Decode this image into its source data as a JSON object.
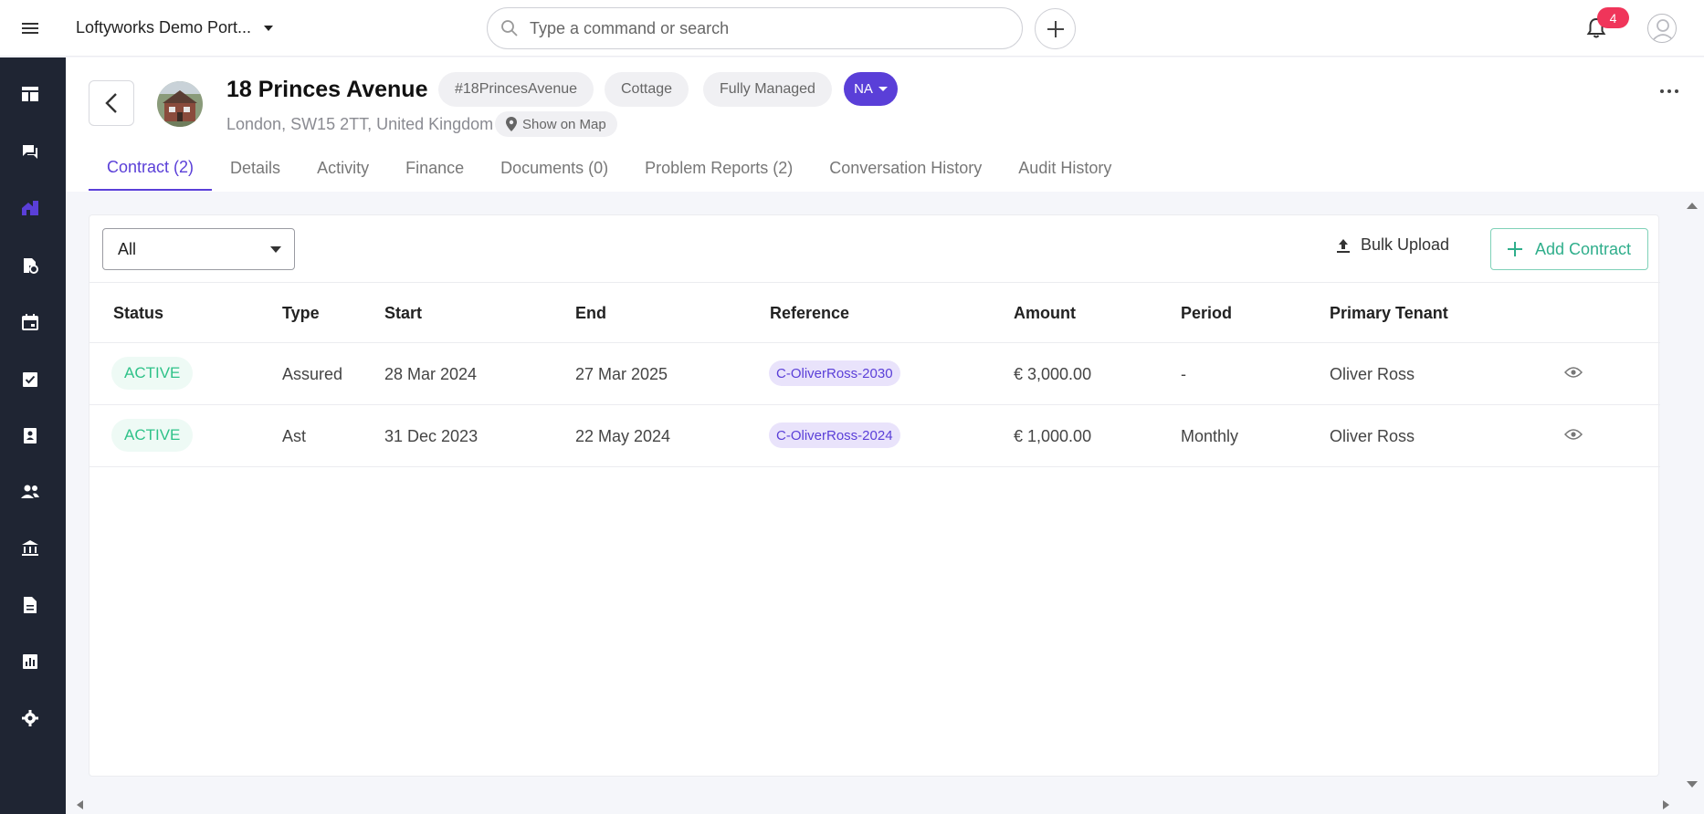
{
  "header": {
    "portfolio_name": "Loftyworks Demo Port...",
    "search_placeholder": "Type a command or search",
    "notification_count": "4"
  },
  "sidebar": {
    "items": [
      "dashboard-icon",
      "messages-icon",
      "properties-icon",
      "tenancies-icon",
      "calendar-icon",
      "tasks-icon",
      "contacts-icon",
      "people-icon",
      "bank-icon",
      "documents-icon",
      "reports-icon",
      "settings-icon"
    ],
    "active_index": 2,
    "bg_color": "#1f2533",
    "active_color": "#5a3fd8"
  },
  "property": {
    "title": "18 Princes Avenue",
    "tags": [
      "#18PrincesAvenue",
      "Cottage",
      "Fully Managed"
    ],
    "owner_initials": "NA",
    "address": "London, SW15 2TT, United Kingdom",
    "map_label": "Show on Map"
  },
  "tabs": [
    {
      "label": "Contract (2)",
      "active": true
    },
    {
      "label": "Details",
      "active": false
    },
    {
      "label": "Activity",
      "active": false
    },
    {
      "label": "Finance",
      "active": false
    },
    {
      "label": "Documents (0)",
      "active": false
    },
    {
      "label": "Problem Reports (2)",
      "active": false
    },
    {
      "label": "Conversation History",
      "active": false
    },
    {
      "label": "Audit History",
      "active": false
    }
  ],
  "contracts": {
    "filter_value": "All",
    "bulk_upload_label": "Bulk Upload",
    "add_contract_label": "Add Contract",
    "columns": [
      "Status",
      "Type",
      "Start",
      "End",
      "Reference",
      "Amount",
      "Period",
      "Primary Tenant"
    ],
    "rows": [
      {
        "status": "ACTIVE",
        "type": "Assured",
        "start": "28 Mar 2024",
        "end": "27 Mar 2025",
        "reference": "C-OliverRoss-2030",
        "amount": "€ 3,000.00",
        "period": "-",
        "tenant": "Oliver Ross"
      },
      {
        "status": "ACTIVE",
        "type": "Ast",
        "start": "31 Dec 2023",
        "end": "22 May 2024",
        "reference": "C-OliverRoss-2024",
        "amount": "€ 1,000.00",
        "period": "Monthly",
        "tenant": "Oliver Ross"
      }
    ]
  },
  "colors": {
    "accent": "#5a3fd8",
    "success": "#2fc289",
    "badge": "#f0355a"
  }
}
